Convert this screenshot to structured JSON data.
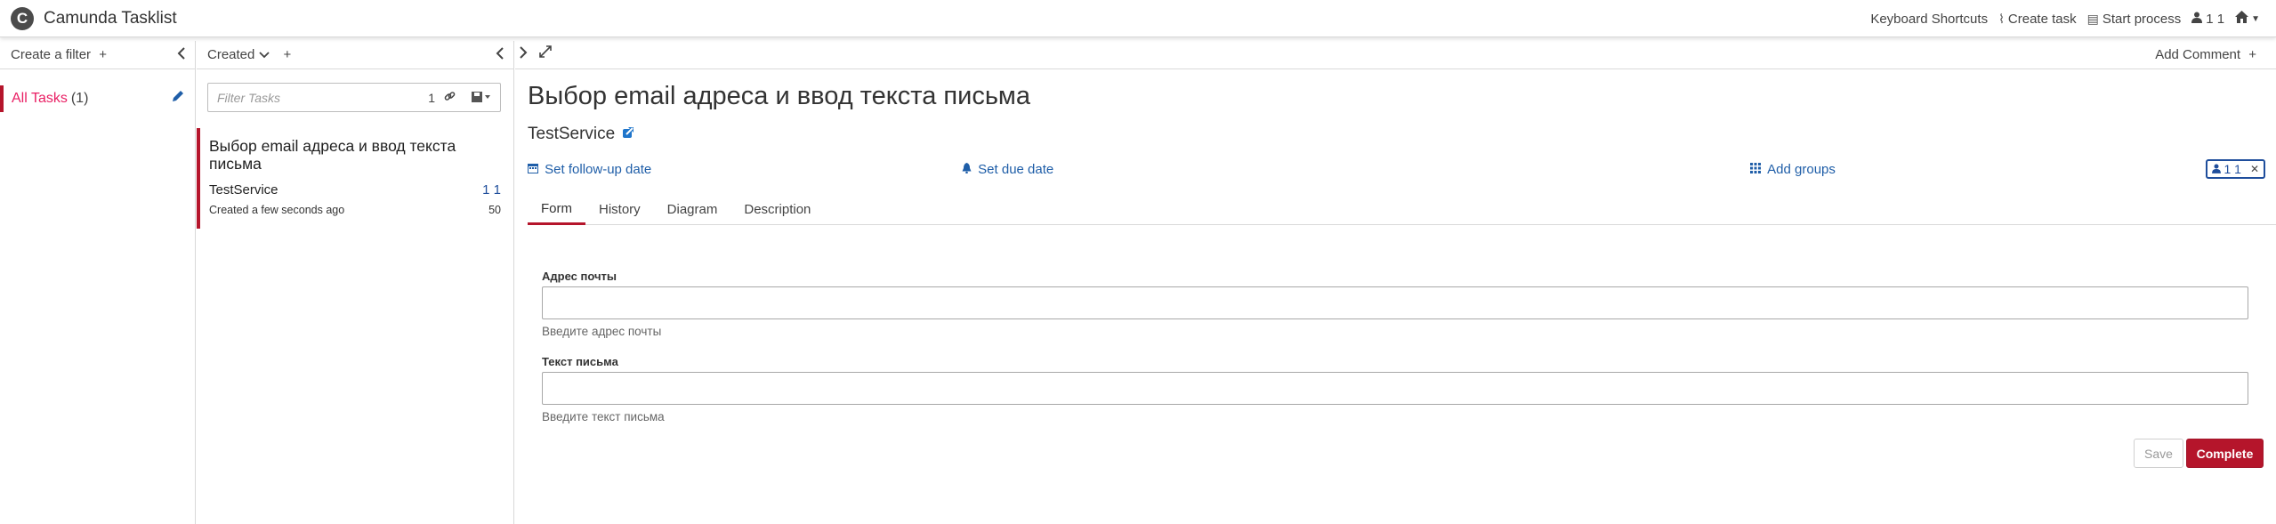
{
  "app": {
    "logo_letter": "C",
    "title": "Camunda Tasklist"
  },
  "header": {
    "keyboard_shortcuts": "Keyboard Shortcuts",
    "create_task": "Create task",
    "start_process": "Start process",
    "user": "1 1",
    "icons": [
      "paperclip-icon",
      "list-icon",
      "user-icon",
      "home-icon"
    ]
  },
  "filters": {
    "create_filter": "Create a filter",
    "items": [
      {
        "name": "All Tasks",
        "count": "(1)"
      }
    ]
  },
  "task_list": {
    "sort_label": "Created",
    "search": {
      "placeholder": "Filter Tasks",
      "count": "1"
    },
    "tasks": [
      {
        "title": "Выбор email адреса и ввод текста письма",
        "process": "TestService",
        "assignee": "1 1",
        "created": "Created a few seconds ago",
        "priority": "50"
      }
    ]
  },
  "detail": {
    "add_comment": "Add Comment",
    "title": "Выбор email адреса и ввод текста письма",
    "process_name": "TestService",
    "follow_up": "Set follow-up date",
    "due_date": "Set due date",
    "add_groups": "Add groups",
    "assignee": "1 1",
    "tabs": [
      "Form",
      "History",
      "Diagram",
      "Description"
    ],
    "active_tab": "Form",
    "form": {
      "fields": [
        {
          "label": "Адрес почты",
          "value": "",
          "help": "Введите адрес почты"
        },
        {
          "label": "Текст письма",
          "value": "",
          "help": "Введите текст письма"
        }
      ],
      "save_label": "Save",
      "complete_label": "Complete"
    }
  },
  "colors": {
    "accent": "#b5152b",
    "link": "#1f5ea8",
    "filter_name": "#e91e63"
  }
}
